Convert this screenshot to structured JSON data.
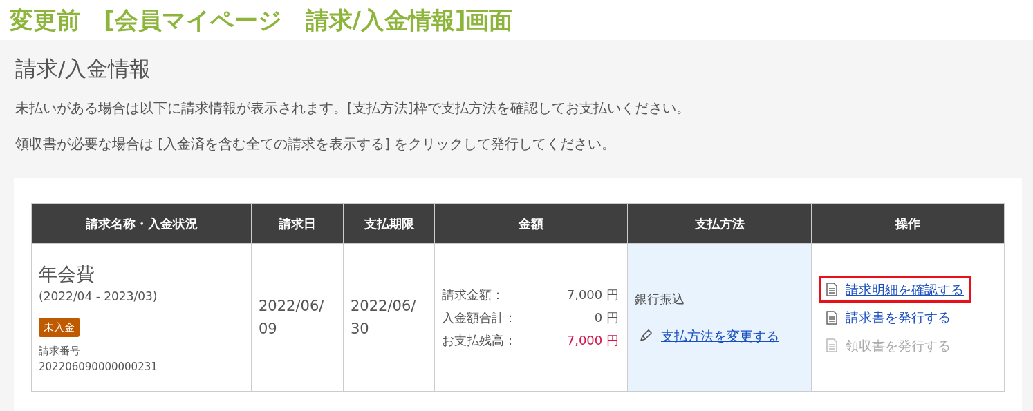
{
  "banner": {
    "title": "変更前　[会員マイページ　請求/入金情報]画面"
  },
  "page": {
    "heading": "請求/入金情報",
    "notes": [
      "未払いがある場合は以下に請求情報が表示されます。[支払方法]枠で支払方法を確認してお支払いください。",
      "領収書が必要な場合は [入金済を含む全ての請求を表示する] をクリックして発行してください。"
    ]
  },
  "table": {
    "columns": [
      "請求名称・入金状況",
      "請求日",
      "支払期限",
      "金額",
      "支払方法",
      "操作"
    ],
    "rows": [
      {
        "name": "年会費",
        "period": "(2022/04 - 2023/03)",
        "status": {
          "label": "未入金",
          "color": "#c05a00"
        },
        "number_label": "請求番号",
        "number": "202206090000000231",
        "billing_date": "2022/06/09",
        "due_date": "2022/06/30",
        "amounts": [
          {
            "label": "請求金額：",
            "value": "7,000 円",
            "alert": false
          },
          {
            "label": "入金額合計：",
            "value": "0 円",
            "alert": false
          },
          {
            "label": "お支払残高：",
            "value": "7,000 円",
            "alert": true
          }
        ],
        "payment": {
          "method": "銀行振込",
          "change_link": "支払方法を変更する"
        },
        "operations": [
          {
            "label": "請求明細を確認する",
            "disabled": false,
            "highlighted": true
          },
          {
            "label": "請求書を発行する",
            "disabled": false,
            "highlighted": false
          },
          {
            "label": "領収書を発行する",
            "disabled": true,
            "highlighted": false
          }
        ]
      }
    ]
  }
}
